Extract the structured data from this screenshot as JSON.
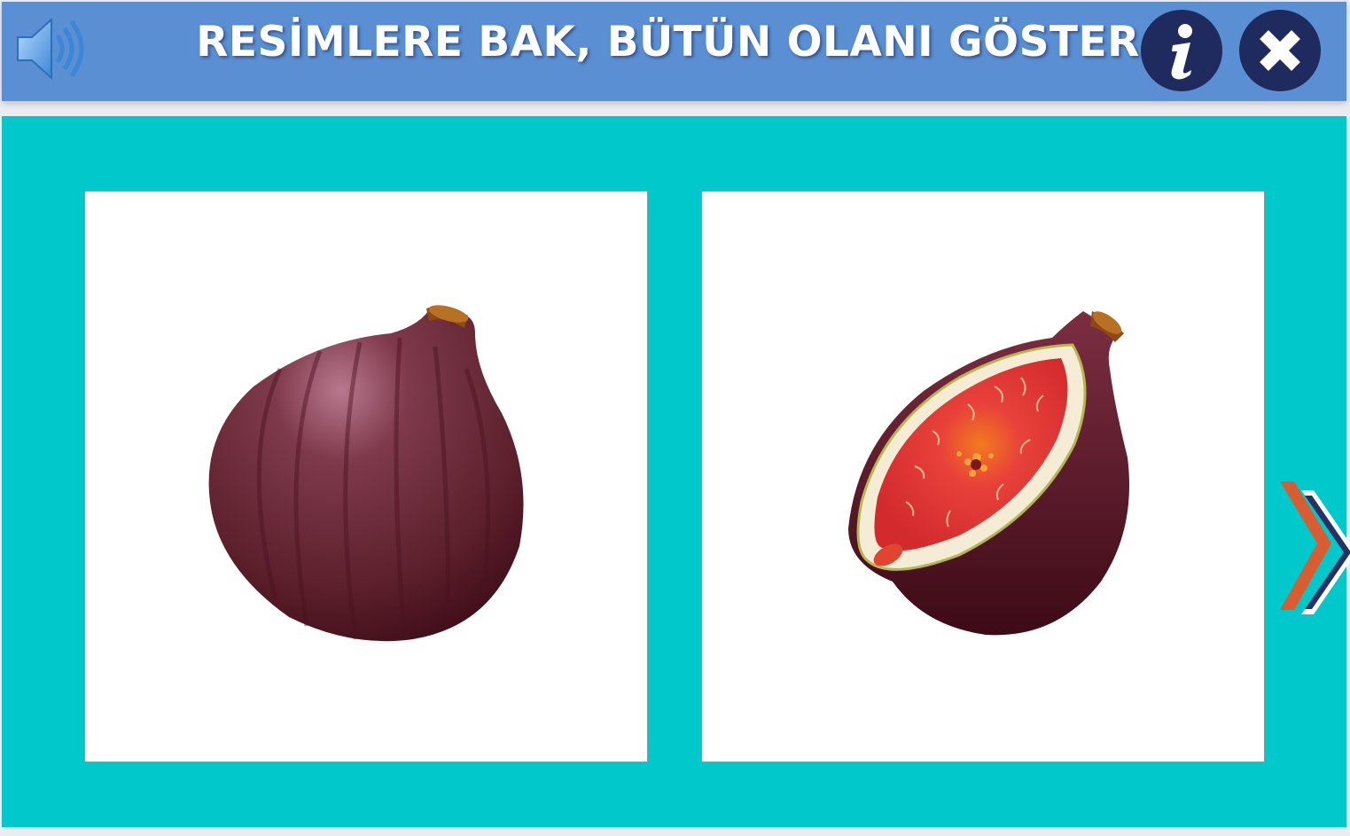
{
  "header": {
    "title": "RESİMLERE BAK, BÜTÜN OLANI GÖSTER",
    "sound_icon": "speaker-icon",
    "info_icon": "info-icon",
    "close_icon": "close-icon",
    "bar_color": "#5a8fd4",
    "button_color": "#1f2b5e"
  },
  "stage": {
    "background_color": "#00c8cb",
    "cards": [
      {
        "image": "whole-fig"
      },
      {
        "image": "half-fig"
      }
    ],
    "next_icon": "chevron-right-icon"
  }
}
